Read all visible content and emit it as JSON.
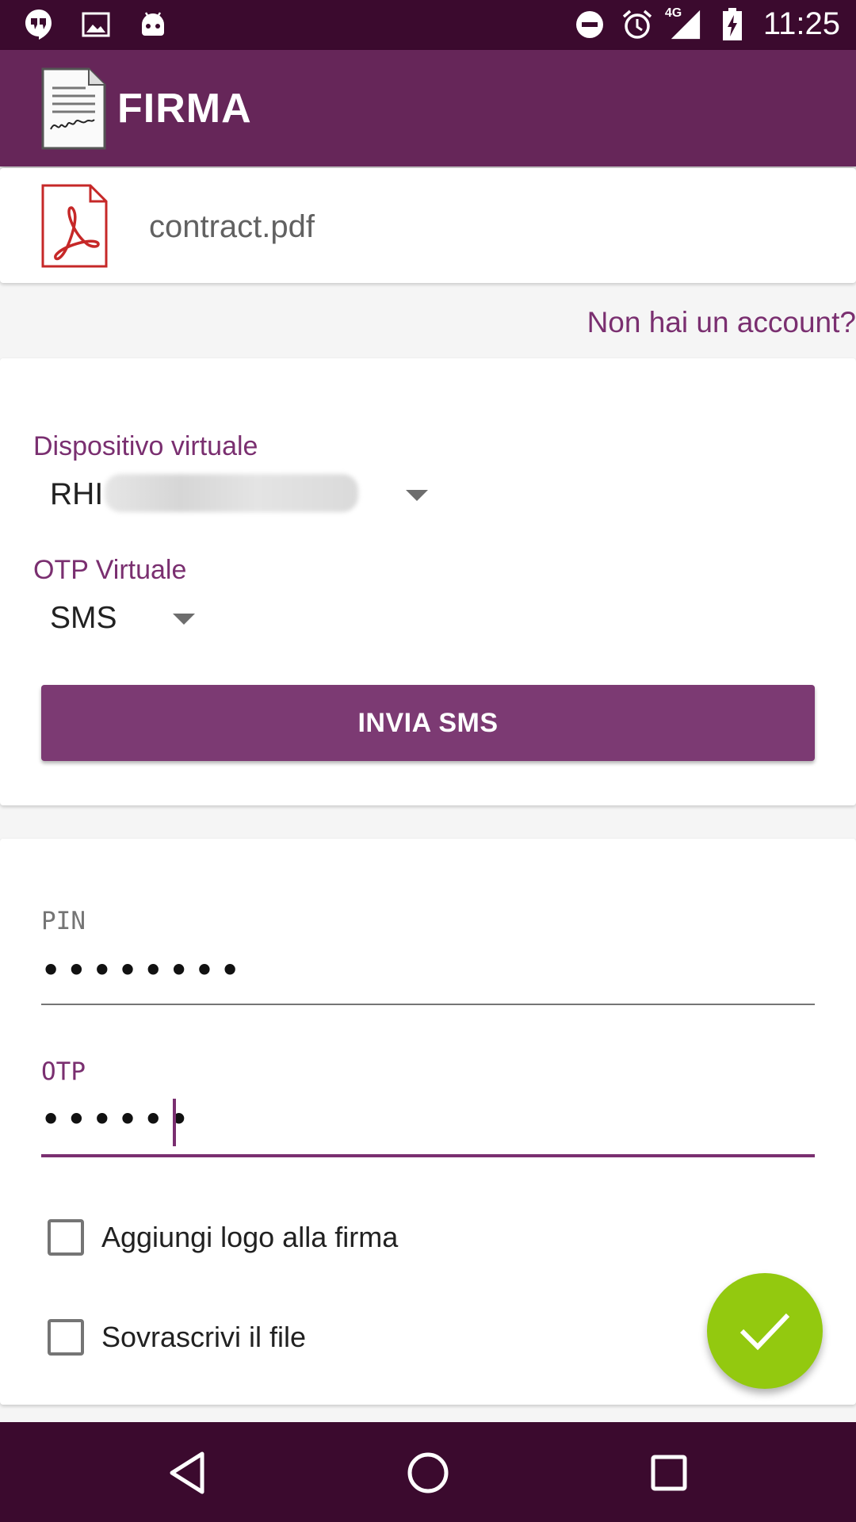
{
  "status_bar": {
    "network": "4G",
    "time": "11:25",
    "icons": [
      "hangouts-icon",
      "image-icon",
      "android-icon",
      "do-not-disturb-icon",
      "alarm-icon",
      "signal-icon",
      "battery-charging-icon"
    ]
  },
  "app_bar": {
    "title": "FIRMA",
    "logo_icon": "signature-document-icon"
  },
  "file": {
    "name": "contract.pdf",
    "icon": "pdf-icon"
  },
  "account_link": "Non hai un account?",
  "device": {
    "label": "Dispositivo virtuale",
    "value_prefix": "RHI"
  },
  "otp_method": {
    "label": "OTP Virtuale",
    "value": "SMS"
  },
  "send_button": "INVIA SMS",
  "pin": {
    "label": "PIN",
    "value": "••••••••"
  },
  "otp": {
    "label": "OTP",
    "value": "••••••"
  },
  "checkboxes": [
    {
      "label": "Aggiungi logo alla firma",
      "checked": false
    },
    {
      "label": "Sovrascrivi il file",
      "checked": false
    }
  ],
  "fab_icon": "check-icon",
  "nav": [
    "back-icon",
    "home-icon",
    "recents-icon"
  ],
  "colors": {
    "primary": "#662659",
    "primary_dark": "#3b0a2e",
    "accent_text": "#7a2f70",
    "button": "#7c3a73",
    "fab": "#93c90f"
  }
}
